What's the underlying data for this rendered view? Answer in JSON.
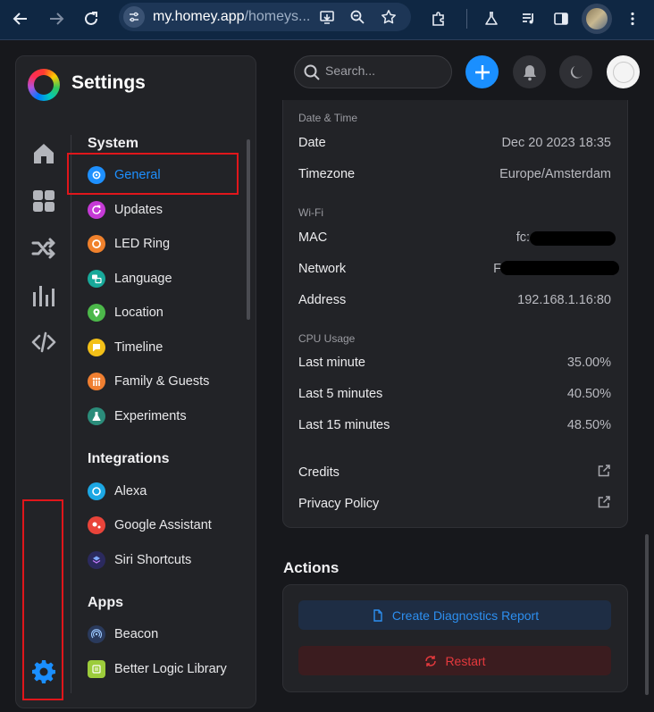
{
  "browser": {
    "url_host": "my.homey.app",
    "url_path": "/homeys..."
  },
  "panel": {
    "title": "Settings",
    "rail": [
      {
        "name": "home-icon"
      },
      {
        "name": "devices-grid-icon"
      },
      {
        "name": "flows-shuffle-icon"
      },
      {
        "name": "insights-bars-icon"
      },
      {
        "name": "developer-code-icon"
      }
    ],
    "sections": [
      {
        "heading": "System",
        "items": [
          {
            "label": "General",
            "color": "#1e90ff",
            "icon": "gear-icon",
            "active": true
          },
          {
            "label": "Updates",
            "color": "#c53ad6",
            "icon": "refresh-icon"
          },
          {
            "label": "LED Ring",
            "color": "#f0812c",
            "icon": "led-ring-icon"
          },
          {
            "label": "Language",
            "color": "#18a99a",
            "icon": "language-icon"
          },
          {
            "label": "Location",
            "color": "#4cb84a",
            "icon": "location-pin-icon"
          },
          {
            "label": "Timeline",
            "color": "#f3c018",
            "icon": "timeline-icon"
          },
          {
            "label": "Family & Guests",
            "color": "#f07f31",
            "icon": "family-icon"
          },
          {
            "label": "Experiments",
            "color": "#2b8c7a",
            "icon": "flask-icon"
          }
        ]
      },
      {
        "heading": "Integrations",
        "items": [
          {
            "label": "Alexa",
            "color": "#1ca7e4",
            "icon": "alexa-icon"
          },
          {
            "label": "Google Assistant",
            "color": "#e9443a",
            "icon": "google-assistant-icon"
          },
          {
            "label": "Siri Shortcuts",
            "color": "#2b2a5e",
            "icon": "siri-shortcuts-icon"
          }
        ]
      },
      {
        "heading": "Apps",
        "items": [
          {
            "label": "Beacon",
            "color": "#2a3a5c",
            "icon": "beacon-icon"
          },
          {
            "label": "Better Logic Library",
            "color": "#9ccc3b",
            "icon": "logic-library-icon"
          }
        ]
      }
    ]
  },
  "search": {
    "placeholder": "Search..."
  },
  "date_time": {
    "heading": "Date & Time",
    "date_label": "Date",
    "date_value": "Dec 20 2023 18:35",
    "timezone_label": "Timezone",
    "timezone_value": "Europe/Amsterdam"
  },
  "wifi": {
    "heading": "Wi-Fi",
    "mac_label": "MAC",
    "mac_value": "fc:",
    "network_label": "Network",
    "network_value": "F",
    "address_label": "Address",
    "address_value": "192.168.1.16:80"
  },
  "cpu": {
    "heading": "CPU Usage",
    "rows": [
      {
        "label": "Last minute",
        "value": "35.00%"
      },
      {
        "label": "Last 5 minutes",
        "value": "40.50%"
      },
      {
        "label": "Last 15 minutes",
        "value": "48.50%"
      }
    ]
  },
  "links": {
    "credits": "Credits",
    "privacy": "Privacy Policy"
  },
  "actions": {
    "title": "Actions",
    "diagnostics": "Create Diagnostics Report",
    "restart": "Restart"
  },
  "colors": {
    "accent": "#1a8fff",
    "danger": "#e5393d",
    "highlight": "#e0161b"
  }
}
